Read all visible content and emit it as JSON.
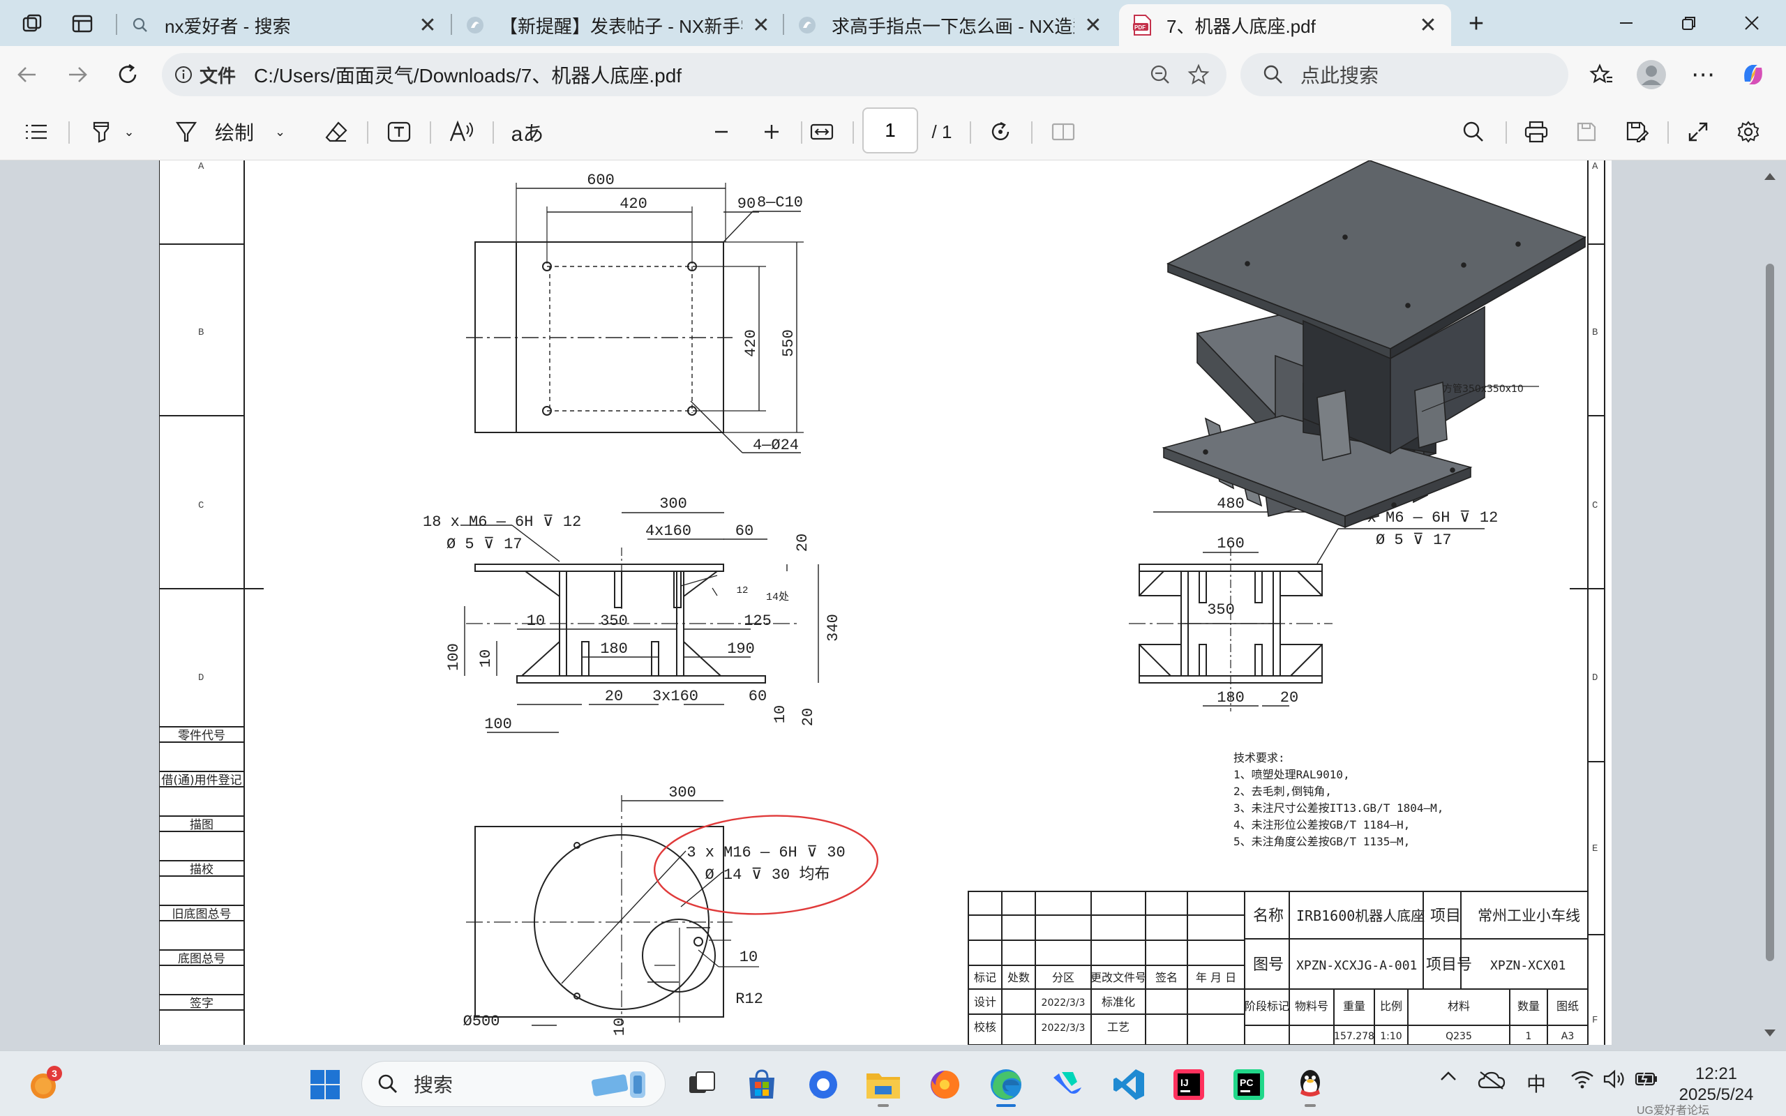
{
  "browser": {
    "tabs": [
      {
        "title": "nx爱好者 - 搜索",
        "icon": "search-icon"
      },
      {
        "title": "【新提醒】发表帖子 - NX新手学堂",
        "icon": "forum-icon"
      },
      {
        "title": "求高手指点一下怎么画 - NX造型技",
        "icon": "forum-icon"
      },
      {
        "title": "7、机器人底座.pdf",
        "icon": "pdf-icon",
        "active": true
      }
    ],
    "url_label": "文件",
    "url": "C:/Users/面面灵气/Downloads/7、机器人底座.pdf",
    "search_placeholder": "点此搜索"
  },
  "pdf_toolbar": {
    "draw_label": "绘制",
    "read_aloud_label": "aあ",
    "page_current": "1",
    "page_total": "/ 1"
  },
  "drawing": {
    "title_block": {
      "name_label": "名称",
      "name_value": "IRB1600机器人底座",
      "project_label": "项目",
      "project_value": "常州工业小车线",
      "drawing_no_label": "图号",
      "drawing_no_value": "XPZN-XCXJG-A-001",
      "project_no_label": "项目号",
      "project_no_value": "XPZN-XCX01",
      "headers": [
        "标记",
        "处数",
        "分区",
        "更改文件号",
        "签名",
        "年 月 日"
      ],
      "row_design": [
        "设计",
        "2022/3/3",
        "标准化"
      ],
      "row_check": [
        "校核",
        "2022/3/3",
        "工艺"
      ],
      "stage_headers": [
        "阶段标记",
        "物料号",
        "重量",
        "比例",
        "材料",
        "数量",
        "图纸"
      ],
      "stage_values": [
        "157.278",
        "1:10",
        "Q235",
        "1",
        "A3"
      ]
    },
    "left_column": [
      "零件代号",
      "借(通)用件登记",
      "描图",
      "描校",
      "旧底图总号",
      "底图总号",
      "签字"
    ],
    "zones_left": [
      "A",
      "B",
      "C",
      "D"
    ],
    "zones_right": [
      "A",
      "B",
      "C",
      "D",
      "E",
      "F"
    ],
    "tech_requirements": {
      "title": "技术要求:",
      "items": [
        "1、喷塑处理RAL9010,",
        "2、去毛刺,倒钝角,",
        "3、未注尺寸公差按IT13.GB/T 1804—M,",
        "4、未注形位公差按GB/T 1184—H,",
        "5、未注角度公差按GB/T 1135—M,"
      ]
    },
    "iso_label": "方管350x350x10",
    "callouts": {
      "top_holes": "8—C10",
      "top_bolt": "4—Ø24",
      "front_thread_1": "18 x  M6 — 6H ⊽ 12",
      "front_thread_2": "Ø 5 ⊽ 17",
      "side_thread_1": "16 x  M6 — 6H ⊽ 12",
      "side_thread_2": "Ø 5 ⊽ 17",
      "bottom_thread_1": "3 x  M16 — 6H ⊽ 30",
      "bottom_thread_2": "Ø 14 ⊽ 30 均布",
      "weld": "14处"
    },
    "dims_top": [
      "600",
      "420",
      "90",
      "420",
      "550"
    ],
    "dims_front": [
      "300",
      "4x160",
      "60",
      "20",
      "340",
      "10",
      "350",
      "125",
      "180",
      "190",
      "100",
      "10",
      "20",
      "3x160",
      "60",
      "10",
      "20",
      "100",
      "12"
    ],
    "dims_side": [
      "480",
      "160",
      "350",
      "180",
      "20"
    ],
    "dims_bottom": [
      "300",
      "10",
      "R12",
      "Ø500",
      "10"
    ]
  },
  "taskbar": {
    "search_label": "搜索",
    "badge_count": "3",
    "ime": "中",
    "time": "12:21",
    "date": "2025/5/24",
    "watermark": "UG爱好者论坛 www.UGSNX.com"
  }
}
